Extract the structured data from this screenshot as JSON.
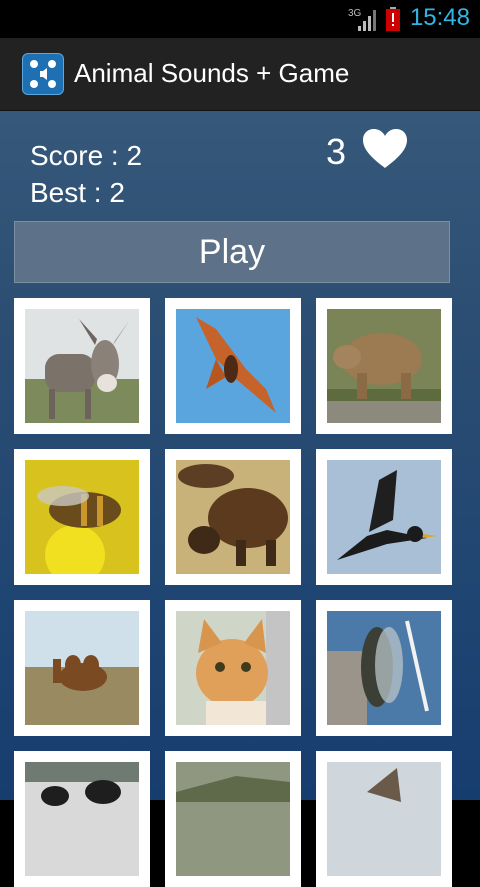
{
  "status_bar": {
    "network": "3G",
    "time": "15:48",
    "icons": [
      "signal-icon",
      "battery-alert-icon"
    ]
  },
  "app_bar": {
    "title": "Animal Sounds + Game",
    "icon": "app-animals-icon"
  },
  "game": {
    "score_label": "Score :",
    "score_value": "2",
    "best_label": "Best :",
    "best_value": "2",
    "lives": "3",
    "play_label": "Play"
  },
  "tiles": [
    {
      "animal": "donkey"
    },
    {
      "animal": "bat"
    },
    {
      "animal": "bear"
    },
    {
      "animal": "bee"
    },
    {
      "animal": "bison"
    },
    {
      "animal": "blackbird"
    },
    {
      "animal": "camel"
    },
    {
      "animal": "cat"
    },
    {
      "animal": "cicada"
    },
    {
      "animal": "cow"
    },
    {
      "animal": "crocodile"
    },
    {
      "animal": "bird"
    }
  ]
}
